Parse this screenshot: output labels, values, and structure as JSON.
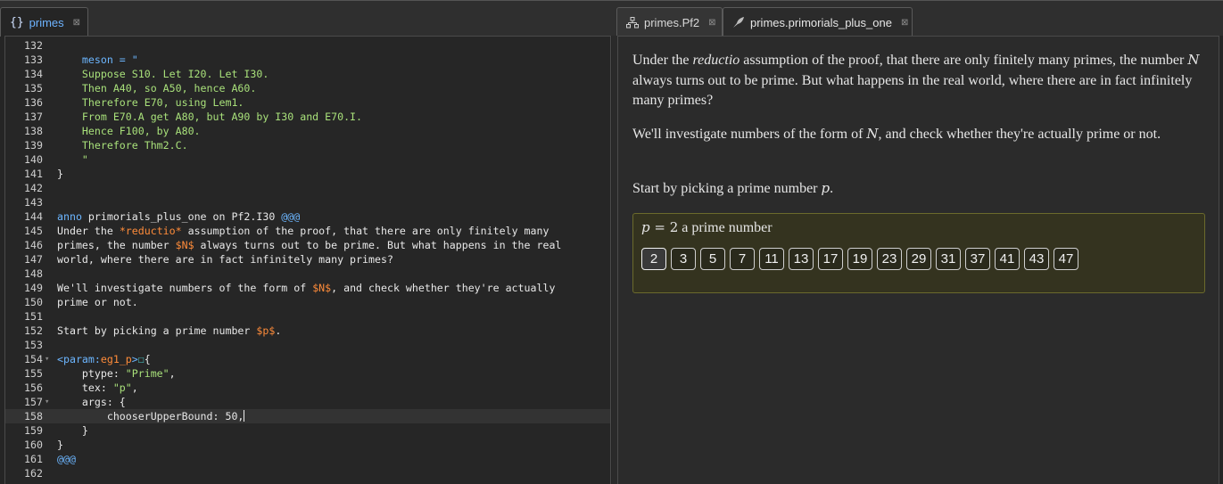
{
  "left_tabs": [
    {
      "label": "primes",
      "icon": "braces-icon"
    }
  ],
  "right_tabs": [
    {
      "label": "primes.Pf2",
      "icon": "sitemap-icon"
    },
    {
      "label": "primes.primorials_plus_one",
      "icon": "quill-icon"
    }
  ],
  "editor": {
    "current_line": 158,
    "lines": [
      {
        "n": "132",
        "fold": "",
        "parts": []
      },
      {
        "n": "133",
        "fold": "",
        "parts": [
          [
            "c-blue",
            "    meson = \""
          ]
        ]
      },
      {
        "n": "134",
        "fold": "",
        "parts": [
          [
            "c-green",
            "    Suppose S10. Let I20. Let I30."
          ]
        ]
      },
      {
        "n": "135",
        "fold": "",
        "parts": [
          [
            "c-green",
            "    Then A40, so A50, hence A60."
          ]
        ]
      },
      {
        "n": "136",
        "fold": "",
        "parts": [
          [
            "c-green",
            "    Therefore E70, using Lem1."
          ]
        ]
      },
      {
        "n": "137",
        "fold": "",
        "parts": [
          [
            "c-green",
            "    From E70.A get A80, but A90 by I30 and E70.I."
          ]
        ]
      },
      {
        "n": "138",
        "fold": "",
        "parts": [
          [
            "c-green",
            "    Hence F100, by A80."
          ]
        ]
      },
      {
        "n": "139",
        "fold": "",
        "parts": [
          [
            "c-green",
            "    Therefore Thm2.C."
          ]
        ]
      },
      {
        "n": "140",
        "fold": "",
        "parts": [
          [
            "c-green",
            "    \""
          ]
        ]
      },
      {
        "n": "141",
        "fold": "",
        "parts": [
          [
            "c-white",
            "}"
          ]
        ]
      },
      {
        "n": "142",
        "fold": "",
        "parts": []
      },
      {
        "n": "143",
        "fold": "",
        "parts": []
      },
      {
        "n": "144",
        "fold": "",
        "parts": [
          [
            "c-blue",
            "anno "
          ],
          [
            "c-white",
            "primorials_plus_one on Pf2.I30 "
          ],
          [
            "c-blue",
            "@@@"
          ]
        ]
      },
      {
        "n": "145",
        "fold": "",
        "parts": [
          [
            "c-white",
            "Under the "
          ],
          [
            "c-orange",
            "*reductio*"
          ],
          [
            "c-white",
            " assumption of the proof, that there are only finitely many"
          ]
        ]
      },
      {
        "n": "146",
        "fold": "",
        "parts": [
          [
            "c-white",
            "primes, the number "
          ],
          [
            "c-orange",
            "$N$"
          ],
          [
            "c-white",
            " always turns out to be prime. But what happens in the real"
          ]
        ]
      },
      {
        "n": "147",
        "fold": "",
        "parts": [
          [
            "c-white",
            "world, where there are in fact infinitely many primes?"
          ]
        ]
      },
      {
        "n": "148",
        "fold": "",
        "parts": []
      },
      {
        "n": "149",
        "fold": "",
        "parts": [
          [
            "c-white",
            "We'll investigate numbers of the form of "
          ],
          [
            "c-orange",
            "$N$"
          ],
          [
            "c-white",
            ", and check whether they're actually"
          ]
        ]
      },
      {
        "n": "150",
        "fold": "",
        "parts": [
          [
            "c-white",
            "prime or not."
          ]
        ]
      },
      {
        "n": "151",
        "fold": "",
        "parts": []
      },
      {
        "n": "152",
        "fold": "",
        "parts": [
          [
            "c-white",
            "Start by picking a prime number "
          ],
          [
            "c-orange",
            "$p$"
          ],
          [
            "c-white",
            "."
          ]
        ]
      },
      {
        "n": "153",
        "fold": "",
        "parts": []
      },
      {
        "n": "154",
        "fold": "▾",
        "parts": [
          [
            "c-blue",
            "<param:"
          ],
          [
            "c-orange",
            "eg1_p"
          ],
          [
            "c-blue",
            ">"
          ],
          [
            "c-teal",
            "☐"
          ],
          [
            "c-white",
            "{"
          ]
        ]
      },
      {
        "n": "155",
        "fold": "",
        "parts": [
          [
            "c-white",
            "    ptype: "
          ],
          [
            "c-green",
            "\"Prime\""
          ],
          [
            "c-white",
            ","
          ]
        ]
      },
      {
        "n": "156",
        "fold": "",
        "parts": [
          [
            "c-white",
            "    tex: "
          ],
          [
            "c-green",
            "\"p\""
          ],
          [
            "c-white",
            ","
          ]
        ]
      },
      {
        "n": "157",
        "fold": "▾",
        "parts": [
          [
            "c-white",
            "    args: {"
          ]
        ]
      },
      {
        "n": "158",
        "fold": "",
        "parts": [
          [
            "c-white",
            "        chooserUpperBound: 50,"
          ]
        ]
      },
      {
        "n": "159",
        "fold": "",
        "parts": [
          [
            "c-white",
            "    }"
          ]
        ]
      },
      {
        "n": "160",
        "fold": "",
        "parts": [
          [
            "c-white",
            "}"
          ]
        ]
      },
      {
        "n": "161",
        "fold": "",
        "parts": [
          [
            "c-blue",
            "@@@"
          ]
        ]
      },
      {
        "n": "162",
        "fold": "",
        "parts": []
      }
    ]
  },
  "view": {
    "para1": [
      [
        "t",
        "Under the "
      ],
      [
        "i",
        "reductio"
      ],
      [
        "t",
        " assumption of the proof, that there are only finitely many primes, the number "
      ],
      [
        "m",
        "N"
      ],
      [
        "t",
        " always turns out to be prime. But what happens in the real world, where there are in fact infinitely many primes?"
      ]
    ],
    "para2": [
      [
        "t",
        "We'll investigate numbers of the form of "
      ],
      [
        "m",
        "N"
      ],
      [
        "t",
        ", and check whether they're actually prime or not."
      ]
    ],
    "para3": [
      [
        "t",
        "Start by picking a prime number "
      ],
      [
        "m",
        "p"
      ],
      [
        "t",
        "."
      ]
    ],
    "chooser": {
      "var": "p",
      "eq": " = 2",
      "caption": "a prime number",
      "selected": "2",
      "choices": [
        "2",
        "3",
        "5",
        "7",
        "11",
        "13",
        "17",
        "19",
        "23",
        "29",
        "31",
        "37",
        "41",
        "43",
        "47"
      ]
    }
  }
}
